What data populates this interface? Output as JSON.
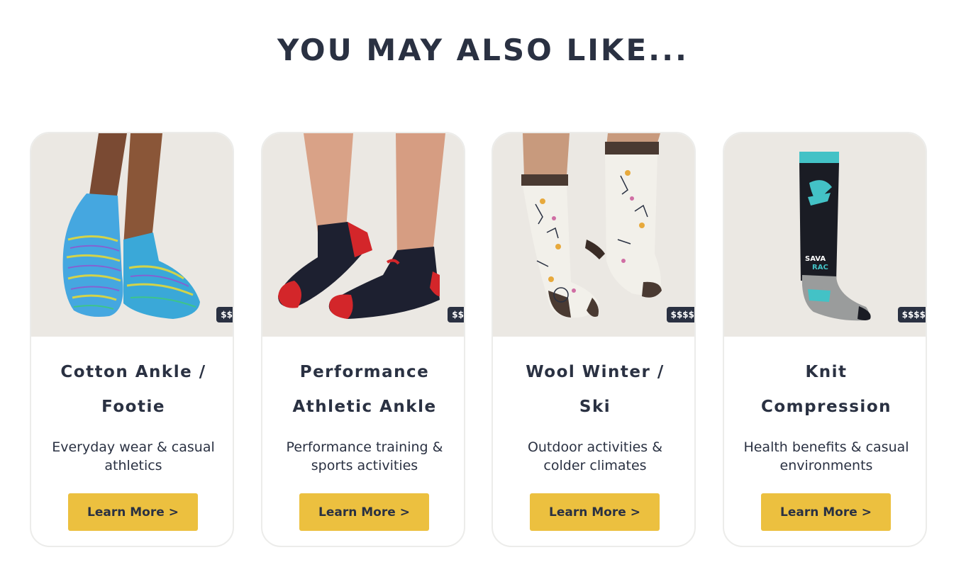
{
  "section": {
    "title": "YOU MAY ALSO LIKE..."
  },
  "products": [
    {
      "title": "Cotton Ankle / Footie",
      "description": "Everyday wear & casual athletics",
      "price_tier": "$$",
      "button_label": "Learn More >",
      "image_icon": "blue-striped-ankle-socks-icon"
    },
    {
      "title": "Performance Athletic Ankle",
      "description": "Performance training & sports activities",
      "price_tier": "$$",
      "button_label": "Learn More >",
      "image_icon": "black-red-athletic-socks-icon"
    },
    {
      "title": "Wool Winter / Ski",
      "description": "Outdoor activities & colder climates",
      "price_tier": "$$$$",
      "button_label": "Learn More >",
      "image_icon": "patterned-wool-crew-socks-icon"
    },
    {
      "title": "Knit Compression",
      "description": "Health benefits & casual environments",
      "price_tier": "$$$$",
      "button_label": "Learn More >",
      "image_icon": "black-teal-compression-sock-icon"
    }
  ],
  "colors": {
    "heading": "#2a3142",
    "button": "#ecc03f",
    "image_background": "#ebe8e3",
    "badge": "#2a3142"
  }
}
